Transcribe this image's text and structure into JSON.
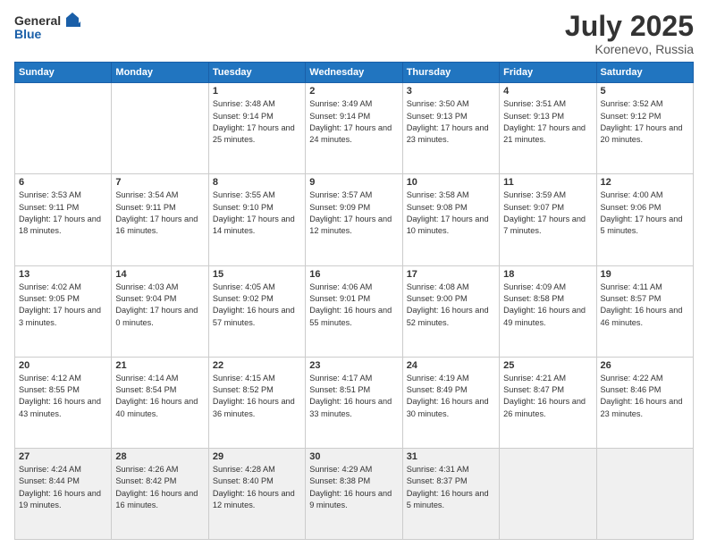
{
  "header": {
    "logo": {
      "general": "General",
      "blue": "Blue"
    },
    "title": "July 2025",
    "subtitle": "Korenevo, Russia"
  },
  "calendar": {
    "days_of_week": [
      "Sunday",
      "Monday",
      "Tuesday",
      "Wednesday",
      "Thursday",
      "Friday",
      "Saturday"
    ],
    "weeks": [
      [
        {
          "day": "",
          "info": ""
        },
        {
          "day": "",
          "info": ""
        },
        {
          "day": "1",
          "info": "Sunrise: 3:48 AM\nSunset: 9:14 PM\nDaylight: 17 hours\nand 25 minutes."
        },
        {
          "day": "2",
          "info": "Sunrise: 3:49 AM\nSunset: 9:14 PM\nDaylight: 17 hours\nand 24 minutes."
        },
        {
          "day": "3",
          "info": "Sunrise: 3:50 AM\nSunset: 9:13 PM\nDaylight: 17 hours\nand 23 minutes."
        },
        {
          "day": "4",
          "info": "Sunrise: 3:51 AM\nSunset: 9:13 PM\nDaylight: 17 hours\nand 21 minutes."
        },
        {
          "day": "5",
          "info": "Sunrise: 3:52 AM\nSunset: 9:12 PM\nDaylight: 17 hours\nand 20 minutes."
        }
      ],
      [
        {
          "day": "6",
          "info": "Sunrise: 3:53 AM\nSunset: 9:11 PM\nDaylight: 17 hours\nand 18 minutes."
        },
        {
          "day": "7",
          "info": "Sunrise: 3:54 AM\nSunset: 9:11 PM\nDaylight: 17 hours\nand 16 minutes."
        },
        {
          "day": "8",
          "info": "Sunrise: 3:55 AM\nSunset: 9:10 PM\nDaylight: 17 hours\nand 14 minutes."
        },
        {
          "day": "9",
          "info": "Sunrise: 3:57 AM\nSunset: 9:09 PM\nDaylight: 17 hours\nand 12 minutes."
        },
        {
          "day": "10",
          "info": "Sunrise: 3:58 AM\nSunset: 9:08 PM\nDaylight: 17 hours\nand 10 minutes."
        },
        {
          "day": "11",
          "info": "Sunrise: 3:59 AM\nSunset: 9:07 PM\nDaylight: 17 hours\nand 7 minutes."
        },
        {
          "day": "12",
          "info": "Sunrise: 4:00 AM\nSunset: 9:06 PM\nDaylight: 17 hours\nand 5 minutes."
        }
      ],
      [
        {
          "day": "13",
          "info": "Sunrise: 4:02 AM\nSunset: 9:05 PM\nDaylight: 17 hours\nand 3 minutes."
        },
        {
          "day": "14",
          "info": "Sunrise: 4:03 AM\nSunset: 9:04 PM\nDaylight: 17 hours\nand 0 minutes."
        },
        {
          "day": "15",
          "info": "Sunrise: 4:05 AM\nSunset: 9:02 PM\nDaylight: 16 hours\nand 57 minutes."
        },
        {
          "day": "16",
          "info": "Sunrise: 4:06 AM\nSunset: 9:01 PM\nDaylight: 16 hours\nand 55 minutes."
        },
        {
          "day": "17",
          "info": "Sunrise: 4:08 AM\nSunset: 9:00 PM\nDaylight: 16 hours\nand 52 minutes."
        },
        {
          "day": "18",
          "info": "Sunrise: 4:09 AM\nSunset: 8:58 PM\nDaylight: 16 hours\nand 49 minutes."
        },
        {
          "day": "19",
          "info": "Sunrise: 4:11 AM\nSunset: 8:57 PM\nDaylight: 16 hours\nand 46 minutes."
        }
      ],
      [
        {
          "day": "20",
          "info": "Sunrise: 4:12 AM\nSunset: 8:55 PM\nDaylight: 16 hours\nand 43 minutes."
        },
        {
          "day": "21",
          "info": "Sunrise: 4:14 AM\nSunset: 8:54 PM\nDaylight: 16 hours\nand 40 minutes."
        },
        {
          "day": "22",
          "info": "Sunrise: 4:15 AM\nSunset: 8:52 PM\nDaylight: 16 hours\nand 36 minutes."
        },
        {
          "day": "23",
          "info": "Sunrise: 4:17 AM\nSunset: 8:51 PM\nDaylight: 16 hours\nand 33 minutes."
        },
        {
          "day": "24",
          "info": "Sunrise: 4:19 AM\nSunset: 8:49 PM\nDaylight: 16 hours\nand 30 minutes."
        },
        {
          "day": "25",
          "info": "Sunrise: 4:21 AM\nSunset: 8:47 PM\nDaylight: 16 hours\nand 26 minutes."
        },
        {
          "day": "26",
          "info": "Sunrise: 4:22 AM\nSunset: 8:46 PM\nDaylight: 16 hours\nand 23 minutes."
        }
      ],
      [
        {
          "day": "27",
          "info": "Sunrise: 4:24 AM\nSunset: 8:44 PM\nDaylight: 16 hours\nand 19 minutes."
        },
        {
          "day": "28",
          "info": "Sunrise: 4:26 AM\nSunset: 8:42 PM\nDaylight: 16 hours\nand 16 minutes."
        },
        {
          "day": "29",
          "info": "Sunrise: 4:28 AM\nSunset: 8:40 PM\nDaylight: 16 hours\nand 12 minutes."
        },
        {
          "day": "30",
          "info": "Sunrise: 4:29 AM\nSunset: 8:38 PM\nDaylight: 16 hours\nand 9 minutes."
        },
        {
          "day": "31",
          "info": "Sunrise: 4:31 AM\nSunset: 8:37 PM\nDaylight: 16 hours\nand 5 minutes."
        },
        {
          "day": "",
          "info": ""
        },
        {
          "day": "",
          "info": ""
        }
      ]
    ]
  }
}
